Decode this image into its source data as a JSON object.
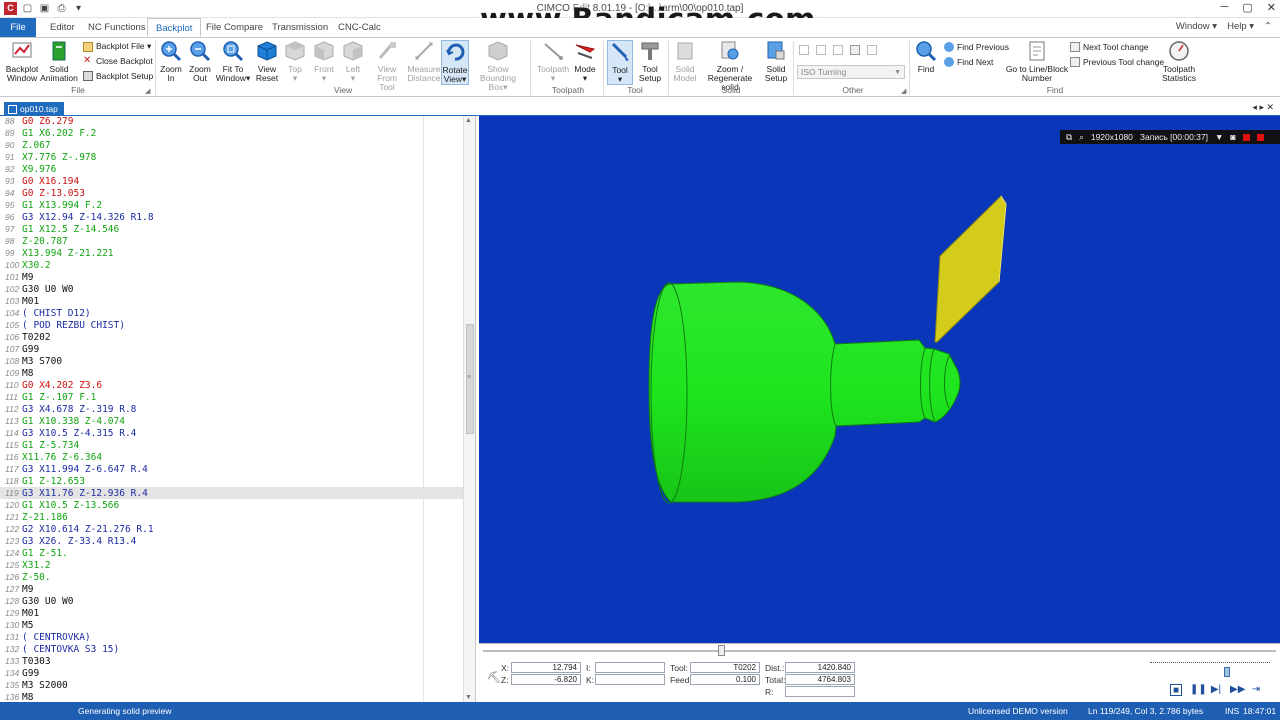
{
  "titlebar": {
    "title": "CIMCO Edit 8.01.19 - [O:\\...\\arm\\00\\op010.tap]",
    "controls": [
      "─",
      "▢",
      "✕"
    ]
  },
  "watermark": "www.Bandicam.com",
  "menu": {
    "file": "File",
    "tabs": [
      "Editor",
      "NC Functions",
      "Backplot",
      "File Compare",
      "Transmission",
      "CNC-Calc"
    ],
    "active": "Backplot",
    "right": [
      "Window ▾",
      "Help ▾",
      "⌃"
    ]
  },
  "ribbon": {
    "file_group": {
      "label": "File",
      "backplot_window": "Backplot\nWindow",
      "solid_animation": "Solid\nAnimation",
      "backplot_file": "Backplot File ▾",
      "close_backplot": "Close Backplot",
      "backplot_setup": "Backplot Setup"
    },
    "view_group": {
      "label": "View",
      "buttons": [
        "Zoom\nIn",
        "Zoom\nOut",
        "Fit To\nWindow▾",
        "View\nReset",
        "Top\n▾",
        "Front\n▾",
        "Left\n▾",
        "View From\nTool",
        "Measure\nDistance",
        "Rotate\nView▾",
        "Show\nBounding Box▾"
      ]
    },
    "toolpath_group": {
      "label": "Toolpath",
      "buttons": [
        "Toolpath\n▾",
        "Mode\n▾"
      ]
    },
    "tool_group": {
      "label": "Tool",
      "buttons": [
        "Tool\n▾",
        "Tool\nSetup"
      ]
    },
    "solid_group": {
      "label": "Solid",
      "buttons": [
        "Solid\nModel",
        "Zoom /\nRegenerate solid",
        "Solid\nSetup"
      ]
    },
    "other_group": {
      "label": "Other",
      "select_value": "ISO Turning"
    },
    "find_group": {
      "label": "Find",
      "find": "Find",
      "find_previous": "Find Previous",
      "find_next": "Find Next",
      "goto_line": "Go to Line/Block\nNumber",
      "next_tool_change": "Next Tool change",
      "previous_tool_change": "Previous Tool change",
      "toolpath_statistics": "Toolpath\nStatistics"
    }
  },
  "doc_tab": {
    "name": "op010.tap",
    "controls": "◂ ▸ ✕"
  },
  "editor": {
    "current_line": 119,
    "lines": [
      {
        "n": "88",
        "t": "G0 Z6.279",
        "c": "#cc1111"
      },
      {
        "n": "89",
        "t": "G1 X6.202 F.2",
        "c": "#11a311"
      },
      {
        "n": "90",
        "t": "Z.067",
        "c": "#11a311"
      },
      {
        "n": "91",
        "t": "X7.776 Z-.978",
        "c": "#11a311"
      },
      {
        "n": "92",
        "t": "X9.976",
        "c": "#11a311"
      },
      {
        "n": "93",
        "t": "G0 X16.194",
        "c": "#cc1111"
      },
      {
        "n": "94",
        "t": "G0 Z-13.053",
        "c": "#cc1111"
      },
      {
        "n": "95",
        "t": "G1 X13.994 F.2",
        "c": "#11a311"
      },
      {
        "n": "96",
        "t": "G3 X12.94 Z-14.326 R1.8",
        "c": "#1c2ca3"
      },
      {
        "n": "97",
        "t": "G1 X12.5 Z-14.546",
        "c": "#11a311"
      },
      {
        "n": "98",
        "t": "Z-20.787",
        "c": "#11a311"
      },
      {
        "n": "99",
        "t": "X13.994 Z-21.221",
        "c": "#11a311"
      },
      {
        "n": "100",
        "t": "X30.2",
        "c": "#11a311"
      },
      {
        "n": "101",
        "t": "M9",
        "c": "#111111"
      },
      {
        "n": "102",
        "t": "G30 U0 W0",
        "c": "#111111"
      },
      {
        "n": "103",
        "t": "M01",
        "c": "#111111"
      },
      {
        "n": "104",
        "t": "( CHIST D12)",
        "c": "#1c2ca3"
      },
      {
        "n": "105",
        "t": "( POD REZBU CHIST)",
        "c": "#1c2ca3"
      },
      {
        "n": "106",
        "t": "T0202",
        "c": "#111111"
      },
      {
        "n": "107",
        "t": "G99",
        "c": "#111111"
      },
      {
        "n": "108",
        "t": "M3 S700",
        "c": "#111111"
      },
      {
        "n": "109",
        "t": "M8",
        "c": "#111111"
      },
      {
        "n": "110",
        "t": "G0 X4.202 Z3.6",
        "c": "#cc1111"
      },
      {
        "n": "111",
        "t": "G1 Z-.107 F.1",
        "c": "#11a311"
      },
      {
        "n": "112",
        "t": "G3 X4.678 Z-.319 R.8",
        "c": "#1c2ca3"
      },
      {
        "n": "113",
        "t": "G1 X10.338 Z-4.074",
        "c": "#11a311"
      },
      {
        "n": "114",
        "t": "G3 X10.5 Z-4.315 R.4",
        "c": "#1c2ca3"
      },
      {
        "n": "115",
        "t": "G1 Z-5.734",
        "c": "#11a311"
      },
      {
        "n": "116",
        "t": "X11.76 Z-6.364",
        "c": "#11a311"
      },
      {
        "n": "117",
        "t": "G3 X11.994 Z-6.647 R.4",
        "c": "#1c2ca3"
      },
      {
        "n": "118",
        "t": "G1 Z-12.653",
        "c": "#11a311"
      },
      {
        "n": "119",
        "t": "G3 X11.76 Z-12.936 R.4",
        "c": "#1c2ca3"
      },
      {
        "n": "120",
        "t": "G1 X10.5 Z-13.566",
        "c": "#11a311"
      },
      {
        "n": "121",
        "t": "Z-21.186",
        "c": "#11a311"
      },
      {
        "n": "122",
        "t": "G2 X10.614 Z-21.276 R.1",
        "c": "#1c2ca3"
      },
      {
        "n": "123",
        "t": "G3 X26. Z-33.4 R13.4",
        "c": "#1c2ca3"
      },
      {
        "n": "124",
        "t": "G1 Z-51.",
        "c": "#11a311"
      },
      {
        "n": "125",
        "t": "X31.2",
        "c": "#11a311"
      },
      {
        "n": "126",
        "t": "Z-50.",
        "c": "#11a311"
      },
      {
        "n": "127",
        "t": "M9",
        "c": "#111111"
      },
      {
        "n": "128",
        "t": "G30 U0 W0",
        "c": "#111111"
      },
      {
        "n": "129",
        "t": "M01",
        "c": "#111111"
      },
      {
        "n": "130",
        "t": "M5",
        "c": "#111111"
      },
      {
        "n": "131",
        "t": "( CENTROVKA)",
        "c": "#1c2ca3"
      },
      {
        "n": "132",
        "t": "( CENTOVKA S3 15)",
        "c": "#1c2ca3"
      },
      {
        "n": "133",
        "t": "T0303",
        "c": "#111111"
      },
      {
        "n": "134",
        "t": "G99",
        "c": "#111111"
      },
      {
        "n": "135",
        "t": "M3 S2000",
        "c": "#111111"
      },
      {
        "n": "136",
        "t": "M8",
        "c": "#111111"
      }
    ]
  },
  "recorder": {
    "resolution": "1920x1080",
    "status": "Запись [00:00:37]"
  },
  "stats": {
    "x_label": "X:",
    "x": "12.794",
    "z_label": "Z:",
    "z": "-6.820",
    "i_label": "I:",
    "k_label": "K:",
    "tool_label": "Tool:",
    "tool": "T0202",
    "feed_label": "Feed:",
    "feed": "0.100",
    "dist_label": "Dist.:",
    "dist": "1420.840",
    "total_label": "Total:",
    "total": "4764.803",
    "r_label": "R:"
  },
  "statusbar": {
    "message": "Generating solid preview",
    "license": "Unlicensed DEMO version",
    "position": "Ln 119/249, Col 3, 2.786 bytes",
    "mode": "INS",
    "time": "18:47:01"
  },
  "colors": {
    "viewport_bg": "#0a37b9",
    "solid": "#1ee51e",
    "tool_insert": "#d4cc1a",
    "accent": "#1f6bbd",
    "rapid": "#cc1111",
    "feed": "#11a311",
    "arc": "#1c2ca3"
  }
}
